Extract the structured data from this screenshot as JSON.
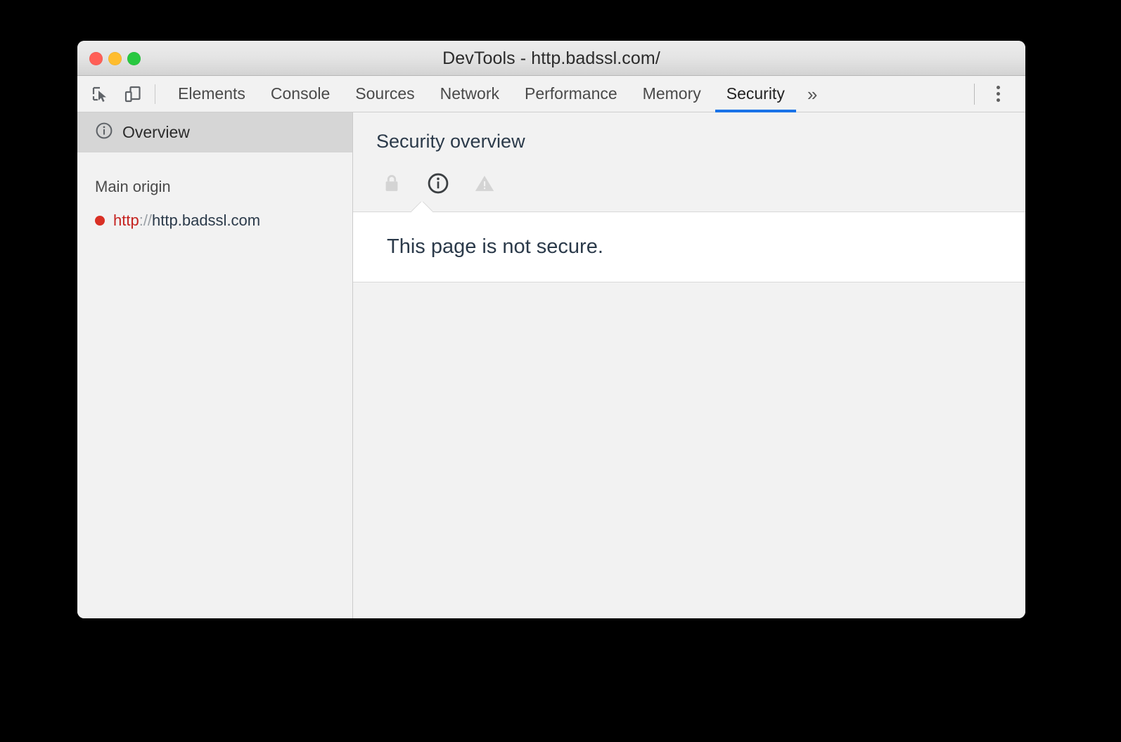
{
  "window": {
    "title": "DevTools - http.badssl.com/",
    "traffic_lights": [
      {
        "name": "close",
        "color": "#ff5f57"
      },
      {
        "name": "minimize",
        "color": "#ffbd2e"
      },
      {
        "name": "zoom",
        "color": "#28c840"
      }
    ]
  },
  "toolbar": {
    "inspect_icon": "inspect-element-icon",
    "device_icon": "device-toolbar-icon",
    "overflow_label": "»",
    "kebab_icon": "more-options-icon"
  },
  "tabs": [
    {
      "label": "Elements",
      "active": false
    },
    {
      "label": "Console",
      "active": false
    },
    {
      "label": "Sources",
      "active": false
    },
    {
      "label": "Network",
      "active": false
    },
    {
      "label": "Performance",
      "active": false
    },
    {
      "label": "Memory",
      "active": false
    },
    {
      "label": "Security",
      "active": true
    }
  ],
  "sidebar": {
    "overview": {
      "label": "Overview",
      "icon": "info-circle-icon",
      "selected": true
    },
    "section_title": "Main origin",
    "origins": [
      {
        "status_color": "#d93025",
        "scheme": "http",
        "separator": "://",
        "host": "http.badssl.com"
      }
    ]
  },
  "main": {
    "title": "Security overview",
    "state_icons": [
      {
        "name": "lock-icon",
        "state": "inactive"
      },
      {
        "name": "info-circle-icon",
        "state": "active"
      },
      {
        "name": "warning-triangle-icon",
        "state": "inactive"
      }
    ],
    "summary": {
      "text": "This page is not secure."
    }
  },
  "colors": {
    "accent": "#1a73e8",
    "insecure": "#d93025",
    "scheme_red": "#c5221f",
    "text_dark": "#2b3a4a",
    "panel_bg": "#f2f2f2",
    "selected_bg": "#d6d6d6",
    "white": "#ffffff"
  }
}
